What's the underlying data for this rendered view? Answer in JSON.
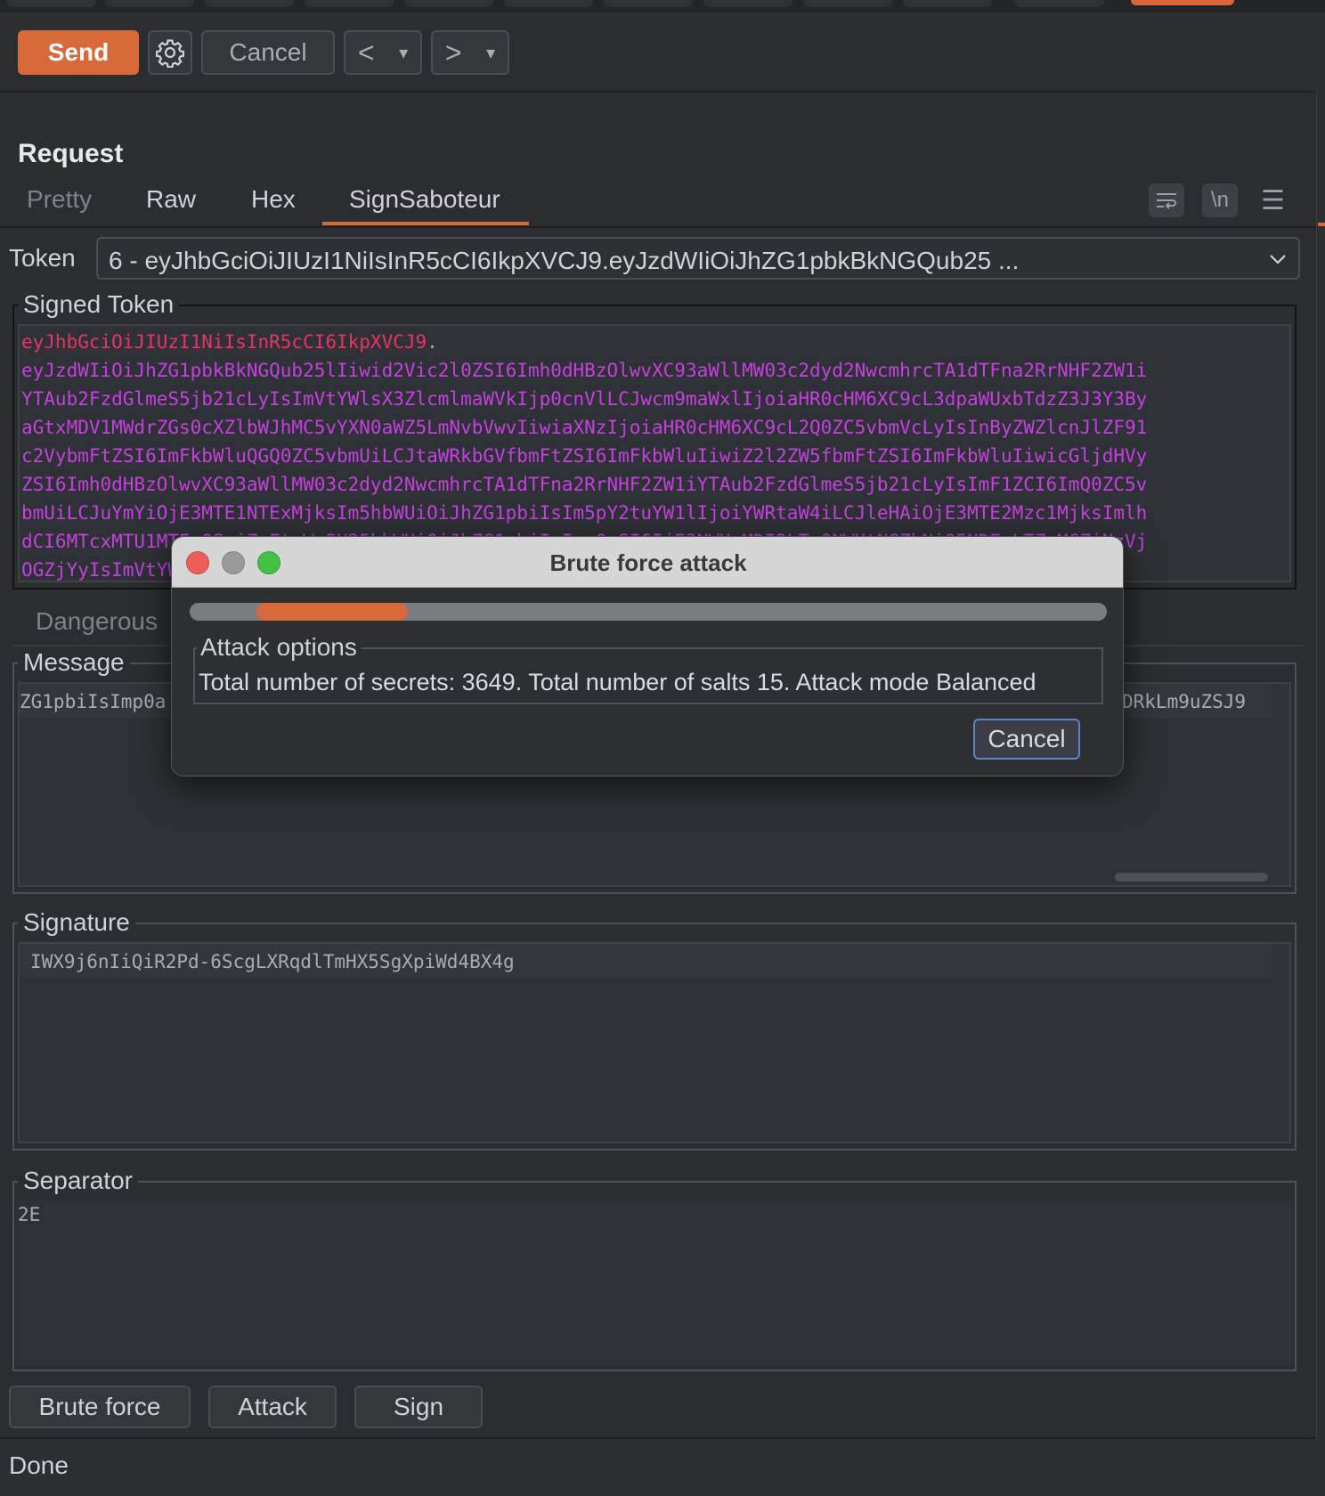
{
  "toolbar": {
    "send_label": "Send",
    "cancel_label": "Cancel",
    "back_icon": "<",
    "forward_icon": ">",
    "dropdown_icon": "▾"
  },
  "request": {
    "title": "Request",
    "tabs": [
      {
        "label": "Pretty"
      },
      {
        "label": "Raw"
      },
      {
        "label": "Hex"
      },
      {
        "label": "SignSaboteur"
      }
    ],
    "active_tab": "SignSaboteur",
    "icons": {
      "wrap": "wrap-lines-icon",
      "newline_label": "\\n",
      "menu": "☰"
    }
  },
  "token": {
    "label": "Token",
    "selected": "6 - eyJhbGciOiJIUzI1NiIsInR5cCI6IkpXVCJ9.eyJzdWIiOiJhZG1pbkBkNGQub25 ..."
  },
  "signed_token": {
    "legend": "Signed Token",
    "header_part": "eyJhbGciOiJIUzI1NiIsInR5cCI6IkpXVCJ9",
    "dot": ".",
    "payload_lines": [
      "eyJzdWIiOiJhZG1pbkBkNGQub25lIiwid2Vic2l0ZSI6Imh0dHBzOlwvXC93aWllMW03c2dyd2NwcmhrcTA1dTFna2RrNHF2ZW1i",
      "YTAub2FzdGlmeS5jb21cLyIsImVtYWlsX3ZlcmlmaWVkIjp0cnVlLCJwcm9maWxlIjoiaHR0cHM6XC9cL3dpaWUxbTdzZ3J3Y3By",
      "aGtxMDV1MWdrZGs0cXZlbWJhMC5vYXN0aWZ5LmNvbVwvIiwiaXNzIjoiaHR0cHM6XC9cL2Q0ZC5vbmVcLyIsInByZWZlcnJlZF91",
      "c2VybmFtZSI6ImFkbWluQGQ0ZC5vbmUiLCJtaWRkbGVfbmFtZSI6ImFkbWluIiwiZ2l2ZW5fbmFtZSI6ImFkbWluIiwicGljdHVy",
      "ZSI6Imh0dHBzOlwvXC93aWllMW03c2dyd2NwcmhrcTA1dTFna2RrNHF2ZW1iYTAub2FzdGlmeS5jb21cLyIsImF1ZCI6ImQ0ZC5v",
      "bmUiLCJuYmYiOjE3MTE1NTExMjksIm5hbWUiOiJhZG1pbiIsIm5pY2tuYW1lIjoiYWRtaW4iLCJleHAiOjE3MTE2Mzc1MjksImlh",
      "dCI6MTcxMTU1MTEyOSwiZmFtaWx5X25hbWUiOiJhZG1pbiIsImp0aSI6IjE3NWUzMDI2LTc0NWUtNGZhNi05NDFmLTZmMGZiNzVj",
      "OGZjYyIsImVtYWlsIjoiYWRtaW5AZDRkLm9uZSJ9"
    ]
  },
  "dangerous_label": "Dangerous",
  "message": {
    "legend": "Message",
    "text": "eyJhbGciOiJIUzI1NiIsInR5cCI6IkpXVCJ9.eyJzdWIiOiJhZG1pbiIsImp0aSI6IjE3NWUzMDI2LTc0NWUtNGZhNi05NDFmLTZmMGZiNzVjOGZjYyIsImVtYWlsIjoiYWRtaW5AZDRkLm9uZSJ9",
    "visible_left": "ZG1pbiIsImp0a",
    "visible_right": "DRkLm9uZSJ9"
  },
  "signature": {
    "legend": "Signature",
    "text": "IWX9j6nIiQiR2Pd-6ScgLXRqdlTmHX5SgXpiWd4BX4g"
  },
  "separator": {
    "legend": "Separator",
    "text": "2E"
  },
  "bottom_buttons": {
    "brute_force": "Brute force",
    "attack": "Attack",
    "sign": "Sign"
  },
  "status": "Done",
  "dialog": {
    "title": "Brute force attack",
    "progress_start_fraction": 0.073,
    "progress_fraction": 0.165,
    "options_legend": "Attack options",
    "options_text": "Total number of secrets: 3649. Total number of salts 15. Attack mode Balanced",
    "cancel_label": "Cancel"
  },
  "colors": {
    "accent": "#d8693a",
    "token_header": "#e8336a",
    "token_payload": "#c640e0",
    "close_light": "#ec5f58",
    "minimize_light": "#9a9a9a",
    "zoom_light": "#46bf45"
  }
}
